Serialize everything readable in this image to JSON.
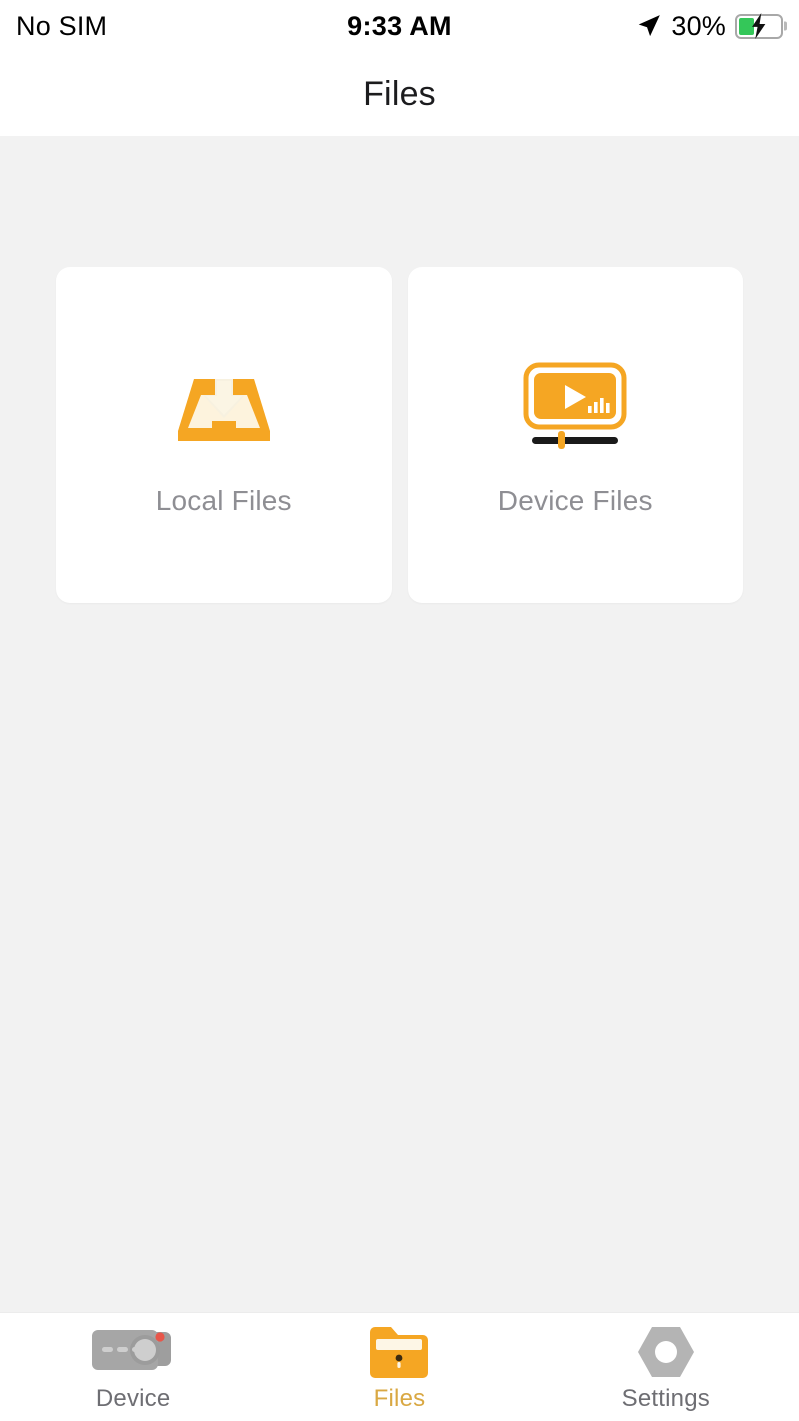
{
  "status_bar": {
    "carrier": "No SIM",
    "time": "9:33 AM",
    "battery_percent": "30%",
    "battery_level": 30,
    "battery_charging": true,
    "location_icon": "location-arrow-icon",
    "battery_icon": "battery-charging-icon",
    "battery_color": "#34c759"
  },
  "header": {
    "title": "Files"
  },
  "theme": {
    "accent": "#f5a623",
    "accent_active_text": "#d9a843",
    "background": "#f2f2f2",
    "card_background": "#ffffff",
    "label_gray": "#8e8e93",
    "tab_inactive": "#6e6e73",
    "icon_gray": "#a9a9a9"
  },
  "main": {
    "cards": [
      {
        "label": "Local Files",
        "icon": "download-tray-icon"
      },
      {
        "label": "Device Files",
        "icon": "video-player-icon"
      }
    ]
  },
  "tab_bar": {
    "items": [
      {
        "label": "Device",
        "icon": "dashcam-icon",
        "active": false
      },
      {
        "label": "Files",
        "icon": "folder-icon",
        "active": true
      },
      {
        "label": "Settings",
        "icon": "hex-nut-gear-icon",
        "active": false
      }
    ]
  }
}
